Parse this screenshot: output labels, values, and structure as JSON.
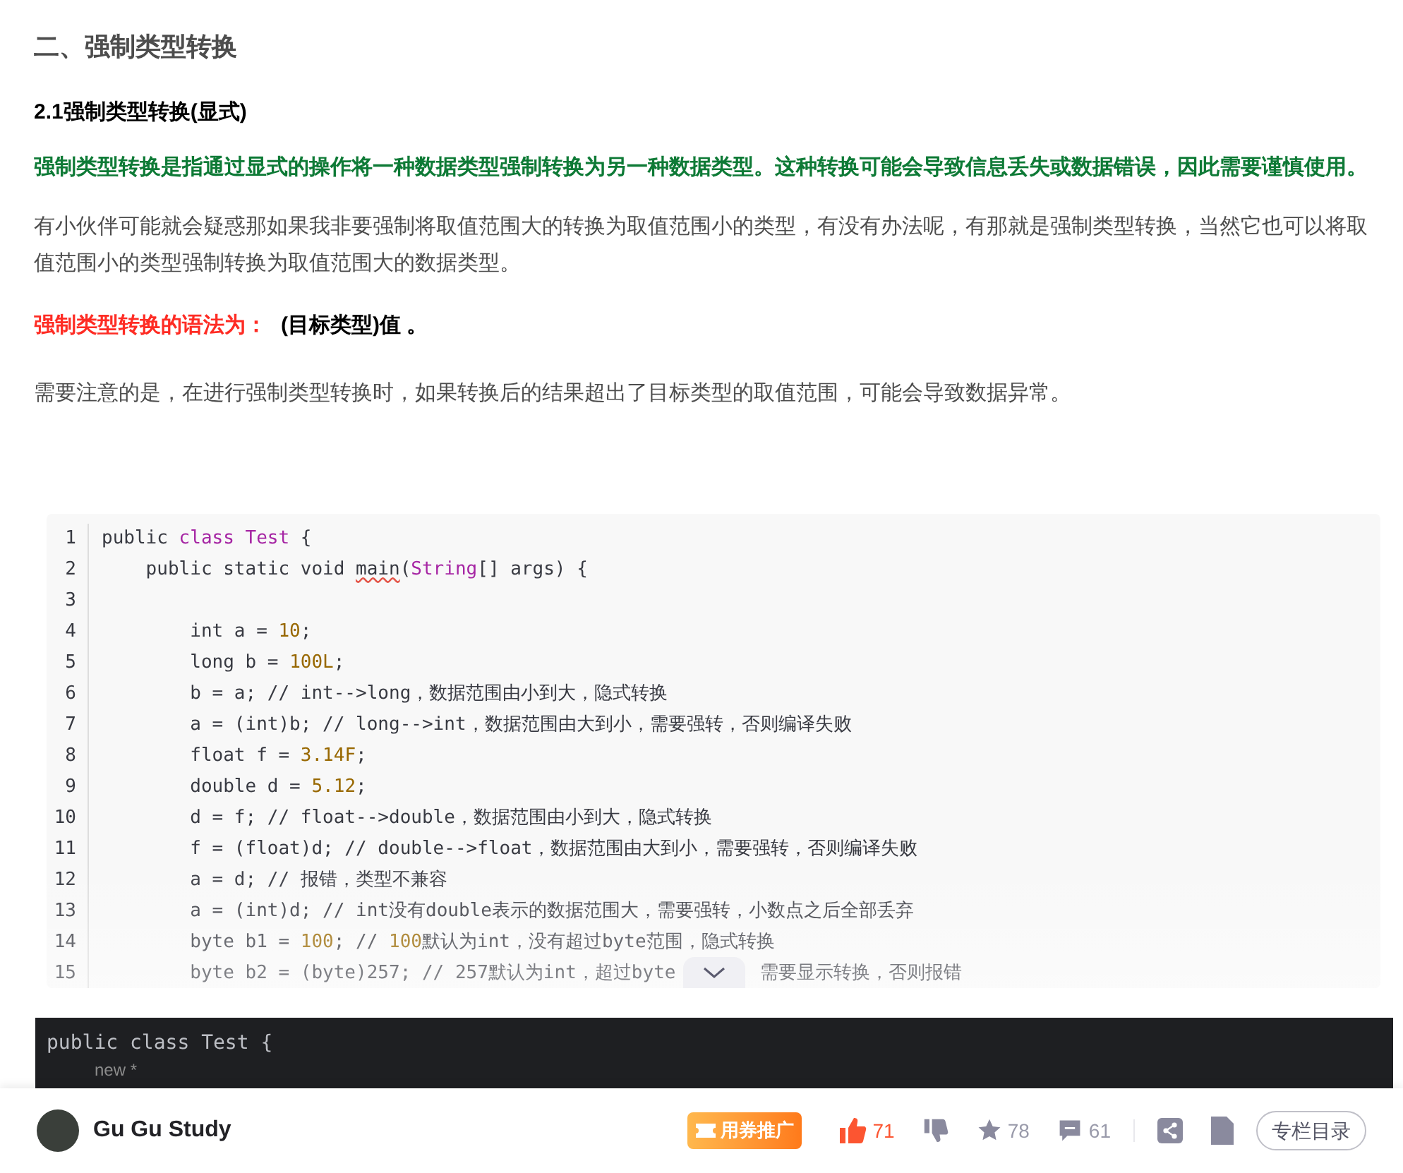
{
  "heading": "二、强制类型转换",
  "subheading": "2.1强制类型转换(显式)",
  "highlight": "强制类型转换是指通过显式的操作将一种数据类型强制转换为另一种数据类型。这种转换可能会导致信息丢失或数据错误，因此需要谨慎使用。",
  "paragraph_1": "有小伙伴可能就会疑惑那如果我非要强制将取值范围大的转换为取值范围小的类型，有没有办法呢，有那就是强制类型转换，当然它也可以将取值范围小的类型强制转换为取值范围大的数据类型。",
  "syntax": {
    "label": "强制类型转换的语法为：",
    "value": "(目标类型)值 。"
  },
  "paragraph_2": "需要注意的是，在进行强制类型转换时，如果转换后的结果超出了目标类型的取值范围，可能会导致数据异常。",
  "code_block": {
    "lines": [
      {
        "number": "1",
        "tokens": [
          {
            "kind": "plain",
            "t": "public "
          },
          {
            "kind": "keyword",
            "t": "class "
          },
          {
            "kind": "type",
            "t": "Test"
          },
          {
            "kind": "plain",
            "t": " {"
          }
        ]
      },
      {
        "number": "2",
        "tokens": [
          {
            "kind": "plain",
            "t": "    public static void "
          },
          {
            "kind": "flagged",
            "t": "main"
          },
          {
            "kind": "plain",
            "t": "("
          },
          {
            "kind": "type",
            "t": "String"
          },
          {
            "kind": "plain",
            "t": "[] args) {"
          }
        ]
      },
      {
        "number": "3"
      },
      {
        "number": "4",
        "tokens": [
          {
            "kind": "plain",
            "t": "        int a = "
          },
          {
            "kind": "number",
            "t": "10"
          },
          {
            "kind": "plain",
            "t": ";"
          }
        ]
      },
      {
        "number": "5",
        "tokens": [
          {
            "kind": "plain",
            "t": "        long b = "
          },
          {
            "kind": "number",
            "t": "100L"
          },
          {
            "kind": "plain",
            "t": ";"
          }
        ]
      },
      {
        "number": "6",
        "tokens": [
          {
            "kind": "plain",
            "t": "        b = a; // int-->long，数据范围由小到大，隐式转换"
          }
        ]
      },
      {
        "number": "7",
        "tokens": [
          {
            "kind": "plain",
            "t": "        a = (int)b; // long-->int，数据范围由大到小，需要强转，否则编译失败"
          }
        ]
      },
      {
        "number": "8",
        "tokens": [
          {
            "kind": "plain",
            "t": "        float f = "
          },
          {
            "kind": "number",
            "t": "3.14F"
          },
          {
            "kind": "plain",
            "t": ";"
          }
        ]
      },
      {
        "number": "9",
        "tokens": [
          {
            "kind": "plain",
            "t": "        double d = "
          },
          {
            "kind": "number",
            "t": "5.12"
          },
          {
            "kind": "plain",
            "t": ";"
          }
        ]
      },
      {
        "number": "10",
        "tokens": [
          {
            "kind": "plain",
            "t": "        d = f; // float-->double，数据范围由小到大，隐式转换"
          }
        ]
      },
      {
        "number": "11",
        "tokens": [
          {
            "kind": "plain",
            "t": "        f = (float)d; // double-->float，数据范围由大到小，需要强转，否则编译失败"
          }
        ]
      },
      {
        "number": "12",
        "tokens": [
          {
            "kind": "plain",
            "t": "        a = d; // 报错，类型不兼容"
          }
        ]
      },
      {
        "number": "13",
        "tokens": [
          {
            "kind": "plain",
            "t": "        a = (int)d; // int没有double表示的数据范围大，需要强转，小数点之后全部丢弃"
          }
        ]
      },
      {
        "number": "14",
        "tokens": [
          {
            "kind": "plain",
            "t": "        byte b1 = "
          },
          {
            "kind": "number",
            "t": "100"
          },
          {
            "kind": "plain",
            "t": "; // "
          },
          {
            "kind": "number",
            "t": "100"
          },
          {
            "kind": "plain",
            "t": "默认为int，没有超过byte范围，隐式转换"
          }
        ]
      },
      {
        "number": "15",
        "tokens": [
          {
            "kind": "plain",
            "t": "        byte b2 = (byte)257; // 257默认为int，超过byte"
          },
          {
            "kind": "gap",
            "t": "需要显示转换，否则报错"
          }
        ]
      }
    ]
  },
  "ide_screenshot": {
    "lines": [
      "public class Test {",
      "new *"
    ]
  },
  "footer": {
    "author": "Gu Gu Study",
    "promote_button": "用券推广",
    "likes": "71",
    "favorites": "78",
    "comments": "61",
    "catalog_button": "专栏目录"
  }
}
